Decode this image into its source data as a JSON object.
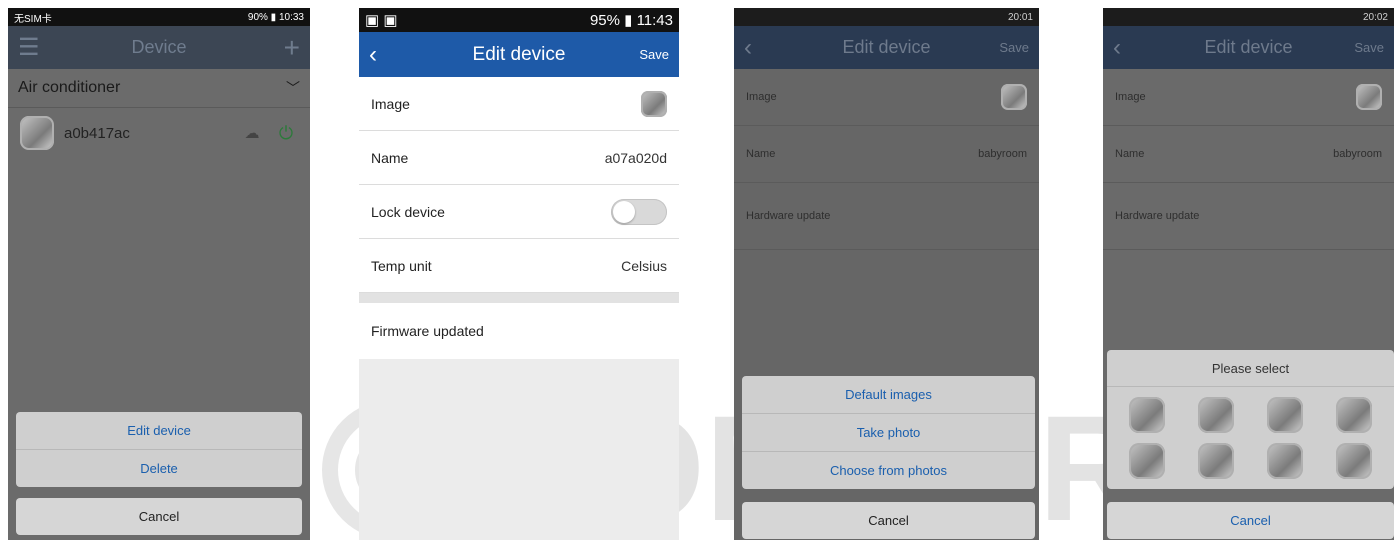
{
  "watermark": {
    "text": "KOMFORT"
  },
  "screen1": {
    "status_left": "无SIM卡",
    "status_right": "90% ▮ 10:33",
    "title": "Device",
    "group_label": "Air conditioner",
    "device_name": "a0b417ac",
    "actions": [
      "Edit device",
      "Delete"
    ],
    "cancel_label": "Cancel"
  },
  "screen2": {
    "status_right": "95% ▮ 11:43",
    "title": "Edit device",
    "save_label": "Save",
    "rows": {
      "image_label": "Image",
      "name_label": "Name",
      "name_value": "a07a020d",
      "lock_label": "Lock device",
      "temp_label": "Temp unit",
      "temp_value": "Celsius",
      "firmware_label": "Firmware updated"
    }
  },
  "screen3": {
    "status_right": "20:01",
    "title": "Edit device",
    "save_label": "Save",
    "image_label": "Image",
    "name_label": "Name",
    "name_value": "babyroom",
    "hardware_label": "Hardware update",
    "actions": [
      "Default images",
      "Take photo",
      "Choose from photos"
    ],
    "cancel_label": "Cancel"
  },
  "screen4": {
    "status_right": "20:02",
    "title": "Edit device",
    "save_label": "Save",
    "image_label": "Image",
    "name_label": "Name",
    "name_value": "babyroom",
    "hardware_label": "Hardware update",
    "select_title": "Please select",
    "cancel_label": "Cancel"
  },
  "icons": {
    "menu": "hamburger-icon",
    "add": "plus-icon",
    "back": "chevron-left-icon",
    "expand": "chevron-down-icon",
    "cloud": "cloud-icon",
    "power": "power-icon"
  }
}
